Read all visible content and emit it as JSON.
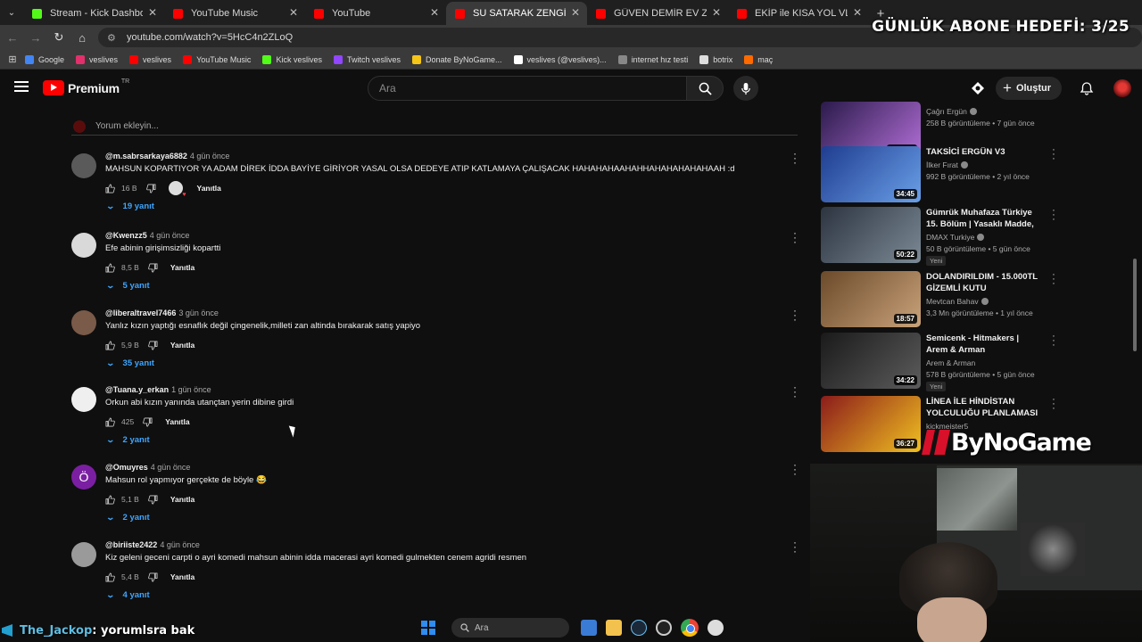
{
  "browser": {
    "tabs": [
      {
        "label": "Stream - Kick Dashboard",
        "icon": "kick-icon",
        "color": "#53fc18"
      },
      {
        "label": "YouTube Music",
        "icon": "youtube-music-icon",
        "color": "#ff0000"
      },
      {
        "label": "YouTube",
        "icon": "youtube-icon",
        "color": "#ff0000"
      },
      {
        "label": "SU SATARAK ZENGİN OLMAK! - Y",
        "icon": "youtube-icon",
        "color": "#ff0000"
      },
      {
        "label": "GÜVEN DEMİR EV ZİYARETİ - Yo",
        "icon": "youtube-icon",
        "color": "#ff0000"
      },
      {
        "label": "EKİP ile KISA YOL VLOG - Tutuk",
        "icon": "youtube-icon",
        "color": "#ff0000"
      }
    ],
    "url": "youtube.com/watch?v=5HcC4n2ZLoQ",
    "bookmarks": [
      {
        "label": "Google",
        "color": "#4285f4"
      },
      {
        "label": "veslives",
        "color": "#e1306c"
      },
      {
        "label": "veslives",
        "color": "#ff0000"
      },
      {
        "label": "YouTube Music",
        "color": "#ff0000"
      },
      {
        "label": "Kick veslives",
        "color": "#53fc18"
      },
      {
        "label": "Twitch veslives",
        "color": "#9146ff"
      },
      {
        "label": "Donate ByNoGame...",
        "color": "#f5c518"
      },
      {
        "label": "veslives (@veslives)...",
        "color": "#ffffff"
      },
      {
        "label": "internet hız testi",
        "color": "#888888"
      },
      {
        "label": "botrix",
        "color": "#dddddd"
      },
      {
        "label": "maç",
        "color": "#ff6a00"
      }
    ]
  },
  "overlay": {
    "goal_text": "GÜNLÜK ABONE HEDEFİ: 3/25",
    "brand": "ByNoGame",
    "chat_user": "The_Jackop",
    "chat_message": ": yorumlsra bak"
  },
  "youtube": {
    "logo_text": "Premium",
    "logo_region": "TR",
    "search_placeholder": "Ara",
    "create_label": "Oluştur",
    "add_comment_placeholder": "Yorum ekleyin...",
    "comments": [
      {
        "author": "@m.sabrsarkaya6882",
        "ago": "4 gün önce",
        "text": "MAHSUN KOPARTIYOR YA ADAM DİREK İDDA BAYİYE GİRİYOR YASAL OLSA DEDEYE ATIP KATLAMAYA ÇALIŞACAK HAHAHAHAAHAHHAHAHAHAHAHAAH :d",
        "likes": "16 B",
        "replies": "19 yanıt",
        "reply_label": "Yanıtla",
        "hearted": true,
        "avatar_color": "#5a5a5a"
      },
      {
        "author": "@Kwenzz5",
        "ago": "4 gün önce",
        "text": "Efe abinin girişimsizliği kopartti",
        "likes": "8,5 B",
        "replies": "5 yanıt",
        "reply_label": "Yanıtla",
        "hearted": false,
        "avatar_color": "#d9d9d9"
      },
      {
        "author": "@liberaltravel7466",
        "ago": "3 gün önce",
        "text": "Yanlız kızın yaptığı esnaflık değil çingenelik,milleti zan altinda bırakarak satış yapiyo",
        "likes": "5,9 B",
        "replies": "35 yanıt",
        "reply_label": "Yanıtla",
        "hearted": false,
        "avatar_color": "#7a5a48"
      },
      {
        "author": "@Tuana.y_erkan",
        "ago": "1 gün önce",
        "text": "Orkun abi kızın yanında utançtan yerin dibine girdi",
        "likes": "425",
        "replies": "2 yanıt",
        "reply_label": "Yanıtla",
        "hearted": false,
        "avatar_color": "#efefef"
      },
      {
        "author": "@Omuyres",
        "ago": "4 gün önce",
        "text": "Mahsun rol yapmıyor gerçekte de böyle 😂",
        "likes": "5,1 B",
        "replies": "2 yanıt",
        "reply_label": "Yanıtla",
        "hearted": false,
        "avatar_color": "#7b1fa2",
        "initial": "Ö"
      },
      {
        "author": "@biriiste2422",
        "ago": "4 gün önce",
        "text": "Kiz geleni geceni carpti o ayri komedi mahsun abinin idda macerasi ayri komedi gulmekten cenem agridi resmen",
        "likes": "5,4 B",
        "replies": "4 yanıt",
        "reply_label": "Yanıtla",
        "hearted": false,
        "avatar_color": "#9a9a9a"
      }
    ],
    "recommendations": [
      {
        "title": "",
        "channel": "Çağrı Ergün",
        "stats": "258 B görüntüleme • 7 gün önce",
        "duration": "1:02:41",
        "new": false,
        "thumb": [
          "#2a1a4a",
          "#b36fd8"
        ],
        "verified": true
      },
      {
        "title": "TAKSİCİ ERGÜN V3",
        "channel": "İlker Fırat",
        "stats": "992 B görüntüleme • 2 yıl önce",
        "duration": "34:45",
        "new": false,
        "thumb": [
          "#1f3c8f",
          "#6aa0e8"
        ],
        "verified": true
      },
      {
        "title": "Gümrük Muhafaza Türkiye 15. Bölüm | Yasaklı Madde, ...",
        "channel": "DMAX Turkiye",
        "stats": "50 B görüntüleme • 5 gün önce",
        "duration": "50:22",
        "new": true,
        "new_label": "Yeni",
        "thumb": [
          "#2c3440",
          "#7c8a96"
        ],
        "verified": true
      },
      {
        "title": "DOLANDIRILDIM - 15.000TL GİZEMLİ KUTU",
        "channel": "Mevtcan Bahav",
        "stats": "3,3 Mn görüntüleme • 1 yıl önce",
        "duration": "18:57",
        "new": false,
        "thumb": [
          "#6b4a2a",
          "#c9a27a"
        ],
        "verified": true
      },
      {
        "title": "Semicenk - Hitmakers | Arem & Arman",
        "channel": "Arem & Arman",
        "stats": "578 B görüntüleme • 5 gün önce",
        "duration": "34:22",
        "new": true,
        "new_label": "Yeni",
        "thumb": [
          "#1a1a1a",
          "#5c5c5c"
        ],
        "verified": false
      },
      {
        "title": "LİNEA İLE HİNDİSTAN YOLCULUĞU PLANLAMASI ...",
        "channel": "kickmeister5",
        "stats": "",
        "duration": "36:27",
        "new": false,
        "thumb": [
          "#8b1b1b",
          "#f0c020"
        ],
        "verified": false
      }
    ]
  },
  "taskbar": {
    "search_placeholder": "Ara"
  }
}
